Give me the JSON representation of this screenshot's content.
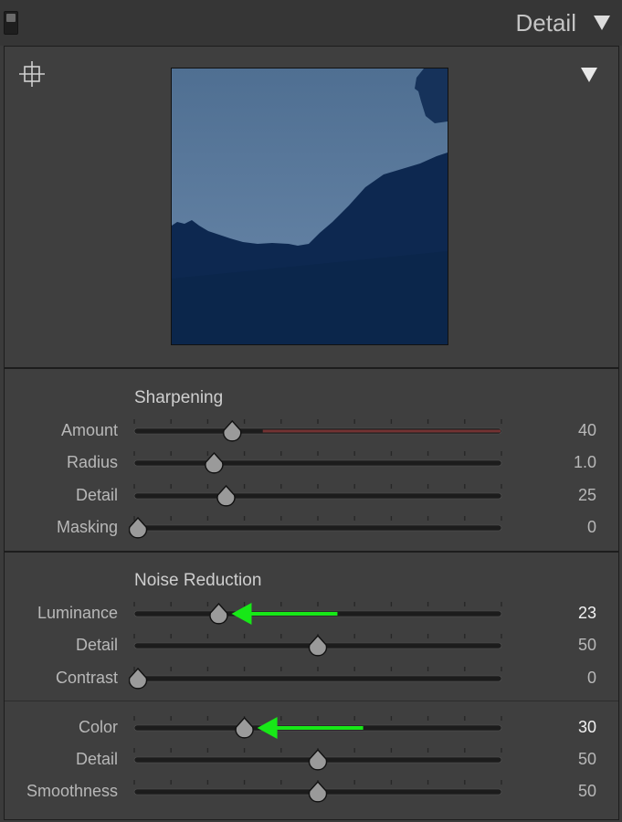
{
  "header": {
    "title": "Detail"
  },
  "sharpening": {
    "title": "Sharpening",
    "rows": [
      {
        "label": "Amount",
        "value": "40",
        "fraction": 0.2667,
        "track_accent": "#8a3a3a"
      },
      {
        "label": "Radius",
        "value": "1.0",
        "fraction": 0.2174
      },
      {
        "label": "Detail",
        "value": "25",
        "fraction": 0.25
      },
      {
        "label": "Masking",
        "value": "0",
        "fraction": 0.0
      }
    ]
  },
  "noise_reduction": {
    "title": "Noise Reduction",
    "rows": [
      {
        "label": "Luminance",
        "value": "23",
        "fraction": 0.23,
        "highlighted": true
      },
      {
        "label": "Detail",
        "value": "50",
        "fraction": 0.5
      },
      {
        "label": "Contrast",
        "value": "0",
        "fraction": 0.0
      },
      {
        "label": "Color",
        "value": "30",
        "fraction": 0.3,
        "highlighted": true
      },
      {
        "label": "Detail",
        "value": "50",
        "fraction": 0.5
      },
      {
        "label": "Smoothness",
        "value": "50",
        "fraction": 0.5
      }
    ]
  },
  "colors": {
    "arrow": "#17e817",
    "panel": "#3f3f3f",
    "track": "#1c1c1c"
  },
  "icons": {
    "collapse": "triangle-down-icon",
    "target": "crosshair-icon"
  }
}
